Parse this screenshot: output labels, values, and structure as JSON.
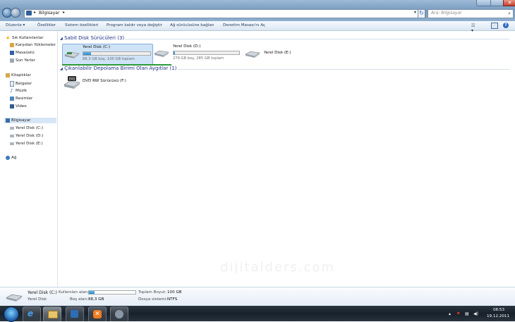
{
  "address": {
    "location": "Bilgisayar",
    "search_placeholder": "Ara: Bilgisayar"
  },
  "toolbar": {
    "organize": "Düzenle ▾",
    "properties": "Özellikler",
    "system_properties": "Sistem özellikleri",
    "uninstall": "Program kaldır veya değiştir",
    "map_drive": "Ağ sürücüsüne bağlan",
    "control_panel": "Denetim Masası'nı Aç"
  },
  "nav": {
    "favorites": "Sık Kullanılanlar",
    "downloads": "Karşıdan Yüklemeler",
    "desktop": "Masaüstü",
    "recent": "Son Yerler",
    "libraries": "Kitaplıklar",
    "documents": "Belgeler",
    "music": "Müzik",
    "pictures": "Resimler",
    "video": "Video",
    "computer": "Bilgisayar",
    "drive_c": "Yerel Disk (C:)",
    "drive_d": "Yerel Disk (D:)",
    "drive_e": "Yerel Disk (E:)",
    "network": "Ağ"
  },
  "groups": {
    "hdd": "Sabit Disk Sürücüleri (3)",
    "removable": "Çıkarılabilir Depolama Birimi Olan Aygıtlar (1)"
  },
  "drives": {
    "c": {
      "name": "Yerel Disk (C:)",
      "info": "88,3 GB boş, 100 GB toplam",
      "used_fraction": 0.117
    },
    "d": {
      "name": "Yerel Disk (D:)",
      "info": "279 GB boş, 285 GB toplam",
      "used_fraction": 0.02
    },
    "e": {
      "name": "Yerel Disk (E:)"
    },
    "f": {
      "name": "DVD RW Sürücüsü (F:)"
    }
  },
  "details": {
    "name": "Yerel Disk (C:)",
    "type": "Yerel Disk",
    "used_label": "Kullanılan alan:",
    "free_label": "Boş alan:",
    "free_value": "88,3 GB",
    "total_label": "Toplam Boyut:",
    "total_value": "100 GB",
    "fs_label": "Dosya sistemi:",
    "fs_value": "NTFS",
    "used_fraction": 0.117
  },
  "watermark": "dijitalders.com",
  "clock": {
    "time": "08:53",
    "date": "19.12.2011"
  },
  "colors": {
    "accent": "#2f87c8",
    "group_header": "#1e3287",
    "selection": "#cfe3f7"
  }
}
